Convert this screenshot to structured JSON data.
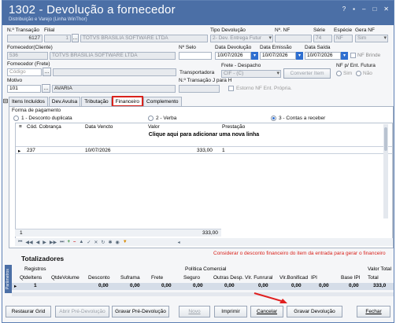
{
  "window": {
    "title": "1302 - Devolução a fornecedor",
    "subtitle": "Distribuição e Varejo (Linha WinThor)",
    "controls": [
      "?",
      "▪",
      "–",
      "□",
      "✕"
    ]
  },
  "header": {
    "transacao_label": "N.º Transação",
    "transacao_value": "6127",
    "filial_label": "Filial",
    "filial_code": "1",
    "filial_name": "TOTVS BRASILIA SOFTWARE LTDA",
    "tipo_devolucao_label": "Tipo Devolução",
    "tipo_devolucao_value": "2- Dev. Entrega Futur",
    "nnf_label": "Nº. NF",
    "nnf_value": "",
    "serie_label": "Série",
    "serie_value": "74",
    "especie_label": "Espécie",
    "especie_value": "NF",
    "gera_nf_label": "Gera NF",
    "gera_nf_value": "Sim",
    "fornecedor_cliente_label": "Fornecedor(Cliente)",
    "fornecedor_cliente_code": "536",
    "fornecedor_cliente_name": "TOTVS BRASILIA SOFTWARE LTDA",
    "selo_label": "Nº Selo",
    "selo_value": "",
    "data_devolucao_label": "Data Devolução",
    "data_devolucao_value": "10/07/2026",
    "data_emissao_label": "Data Emissão",
    "data_emissao_value": "10/07/2026",
    "data_saida_label": "Data Saída",
    "data_saida_value": "10/07/2026",
    "nf_brinde_label": "NF Brinde",
    "fornecedor_frete_label": "Fornecedor (Frete)",
    "fornecedor_frete_placeholder": "Código",
    "transportadora_label": "Transportadora",
    "frete_despacho_label": "Frete - Despacho",
    "frete_despacho_value": "CIF - (C)",
    "converter_item_label": "Converter Item",
    "nf_entrega_futura_label": "NF p/ Ent. Futura",
    "sim_label": "Sim",
    "nao_label": "Não",
    "motivo_label": "Motivo",
    "motivo_code": "101",
    "motivo_desc": "AVARIA",
    "transacao_para_label": "N.º Transação J para H",
    "estorno_label": "Estorno NF Ent. Própria."
  },
  "tabs": [
    "Itens Incluídos",
    "Dev.Avulsa",
    "Tributação",
    "Financeiro",
    "Complemento"
  ],
  "active_tab": "Financeiro",
  "financeiro": {
    "forma_pagamento_label": "Forma de pagamento",
    "options": [
      "1 - Desconto duplicata",
      "2 - Verba",
      "3 - Contas a receber"
    ],
    "selected": "3 - Contas a receber",
    "columns": [
      "Cód. Cobrança",
      "Data Vencto",
      "Valor",
      "Prestação"
    ],
    "add_row_hint": "Clique aqui para adicionar uma nova linha",
    "rows": [
      {
        "cod": "237",
        "vencto": "10/07/2026",
        "valor": "333,00",
        "prestacao": "1"
      }
    ],
    "footer_count": "1",
    "footer_total": "333,00"
  },
  "warning_text": "Considerar o desconto financeiro do item da entrada para gerar o financeiro",
  "totalizadores": {
    "title": "Totalizadores",
    "side_label": "Parâmetros",
    "group_registros": "Registros",
    "group_politica": "Política Comercial",
    "columns": [
      "QtdeItens",
      "QtdeVolume",
      "Desconto",
      "Suframa",
      "Frete",
      "Seguro",
      "Outras Desp.",
      "Vlr. Funrural",
      "Vlr.Bonificad",
      "IPI",
      "Base IPI",
      "Valor Total",
      "Total"
    ],
    "values": [
      "1",
      "",
      "0,00",
      "0,00",
      "0,00",
      "0,00",
      "0,00",
      "0,00",
      "0,00",
      "0,00",
      "0,00",
      "333,00",
      "333,0"
    ]
  },
  "buttons": {
    "restaurar": "Restaurar Grid",
    "abrir": "Abrir Pré-Devolução",
    "gravar_pre": "Gravar Pré-Devolução",
    "novo": "Novo",
    "imprimir": "Imprimir",
    "cancelar": "Cancelar",
    "gravar": "Gravar Devolução",
    "fechar": "Fechar"
  },
  "colors": {
    "titlebar": "#4b6fa6",
    "highlight": "#d9231c",
    "accent": "#2f6fd0"
  }
}
